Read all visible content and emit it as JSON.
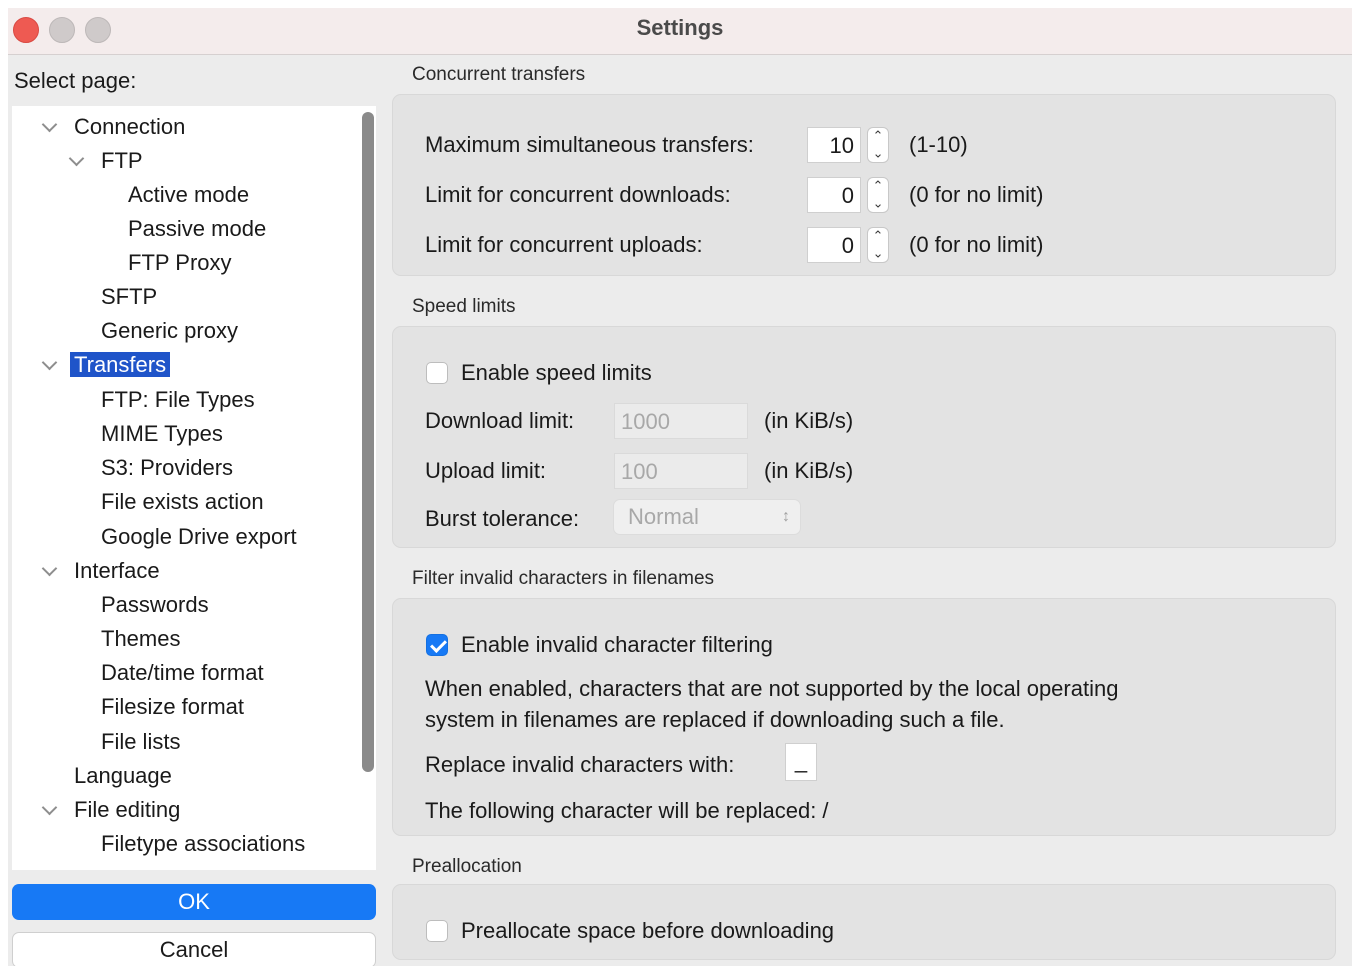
{
  "window": {
    "title": "Settings"
  },
  "sidebar": {
    "select_label": "Select page:",
    "tree": [
      {
        "label": "Connection",
        "expanded": true
      },
      {
        "label": "FTP",
        "expanded": true
      },
      {
        "label": "Active mode"
      },
      {
        "label": "Passive mode"
      },
      {
        "label": "FTP Proxy"
      },
      {
        "label": "SFTP"
      },
      {
        "label": "Generic proxy"
      },
      {
        "label": "Transfers",
        "expanded": true,
        "selected": true
      },
      {
        "label": "FTP: File Types"
      },
      {
        "label": "MIME Types"
      },
      {
        "label": "S3: Providers"
      },
      {
        "label": "File exists action"
      },
      {
        "label": "Google Drive export"
      },
      {
        "label": "Interface",
        "expanded": true
      },
      {
        "label": "Passwords"
      },
      {
        "label": "Themes"
      },
      {
        "label": "Date/time format"
      },
      {
        "label": "Filesize format"
      },
      {
        "label": "File lists"
      },
      {
        "label": "Language"
      },
      {
        "label": "File editing",
        "expanded": true
      },
      {
        "label": "Filetype associations"
      }
    ],
    "ok_label": "OK",
    "cancel_label": "Cancel"
  },
  "concurrent": {
    "title": "Concurrent transfers",
    "max_label": "Maximum simultaneous transfers:",
    "max_value": "10",
    "max_hint": "(1-10)",
    "downloads_label": "Limit for concurrent downloads:",
    "downloads_value": "0",
    "downloads_hint": "(0 for no limit)",
    "uploads_label": "Limit for concurrent uploads:",
    "uploads_value": "0",
    "uploads_hint": "(0 for no limit)"
  },
  "speed": {
    "title": "Speed limits",
    "enable_label": "Enable speed limits",
    "enabled": false,
    "download_label": "Download limit:",
    "download_value": "1000",
    "download_unit": "(in KiB/s)",
    "upload_label": "Upload limit:",
    "upload_value": "100",
    "upload_unit": "(in KiB/s)",
    "burst_label": "Burst tolerance:",
    "burst_value": "Normal"
  },
  "filter": {
    "title": "Filter invalid characters in filenames",
    "enable_label": "Enable invalid character filtering",
    "enabled": true,
    "description_line1": "When enabled, characters that are not supported by the local operating",
    "description_line2": "system in filenames are replaced if downloading such a file.",
    "replace_label": "Replace invalid characters with:",
    "replace_value": "_",
    "following_text": "The following character will be replaced: /"
  },
  "prealloc": {
    "title": "Preallocation",
    "enable_label": "Preallocate space before downloading",
    "enabled": false
  },
  "icons": {
    "close": "close-button",
    "minimize": "minimize-button",
    "zoom": "zoom-button",
    "chevron": "chevron-down-icon",
    "stepper": "up-down-stepper"
  },
  "colors": {
    "selection": "#1f54c9",
    "accent": "#1779f5",
    "close_red": "#ee5a52"
  }
}
